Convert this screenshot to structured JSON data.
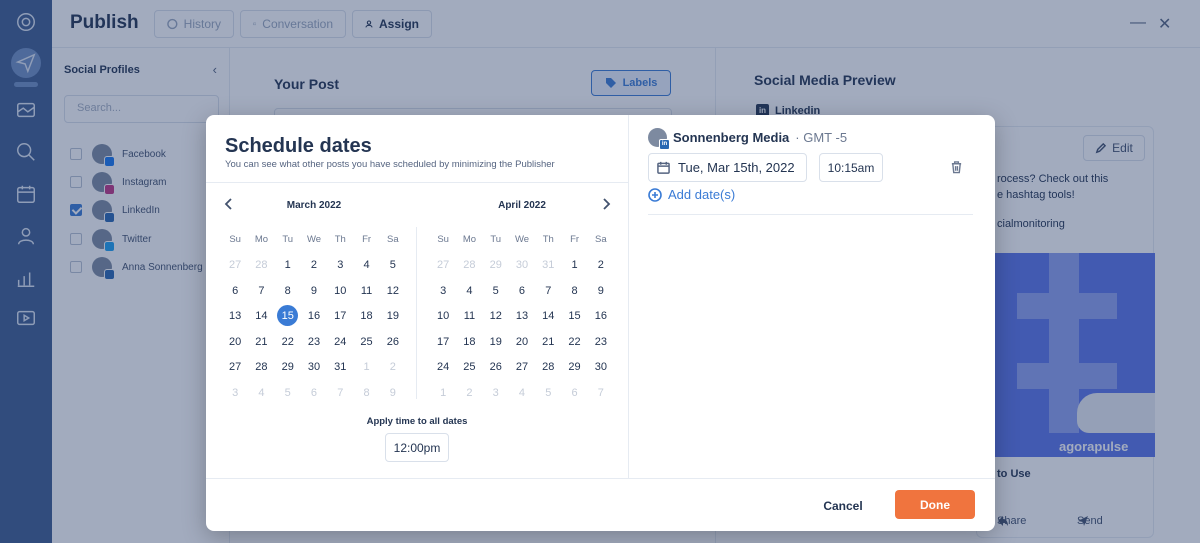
{
  "topbar": {
    "title": "Publish",
    "btn_history": "History",
    "btn_conversation": "Conversation",
    "btn_assign": "Assign"
  },
  "profiles": {
    "heading": "Social Profiles",
    "search_placeholder": "Search...",
    "items": [
      {
        "label": "Facebook",
        "checked": false,
        "badge_color": "#1877f2"
      },
      {
        "label": "Instagram",
        "checked": false,
        "badge_color": "#c13584"
      },
      {
        "label": "LinkedIn",
        "checked": true,
        "badge_color": "#2867b2"
      },
      {
        "label": "Twitter",
        "checked": false,
        "badge_color": "#1da1f2"
      },
      {
        "label": "Anna Sonnenberg",
        "checked": false,
        "badge_color": "#2867b2"
      }
    ]
  },
  "post": {
    "title": "Your Post",
    "labels_button": "Labels"
  },
  "preview": {
    "title": "Social Media Preview",
    "network": "Linkedin",
    "edit_button": "Edit",
    "text_line1": "rocess? Check out this",
    "text_line2": "e hashtag tools!",
    "text_line3": "cialmonitoring",
    "image_brand": "agorapulse",
    "link_title": "to Use",
    "share_label": "Share",
    "send_label": "Send"
  },
  "modal": {
    "title": "Schedule dates",
    "subtitle": "You can see what other posts you have scheduled by minimizing the Publisher",
    "weekdays": [
      "Su",
      "Mo",
      "Tu",
      "We",
      "Th",
      "Fr",
      "Sa"
    ],
    "calendars": [
      {
        "month": "March 2022",
        "weeks": [
          [
            [
              "27",
              1
            ],
            [
              "28",
              1
            ],
            [
              "1",
              0
            ],
            [
              "2",
              0
            ],
            [
              "3",
              0
            ],
            [
              "4",
              0
            ],
            [
              "5",
              0
            ]
          ],
          [
            [
              "6",
              0
            ],
            [
              "7",
              0
            ],
            [
              "8",
              0
            ],
            [
              "9",
              0
            ],
            [
              "10",
              0
            ],
            [
              "11",
              0
            ],
            [
              "12",
              0
            ]
          ],
          [
            [
              "13",
              0
            ],
            [
              "14",
              0
            ],
            [
              "15",
              2
            ],
            [
              "16",
              0
            ],
            [
              "17",
              0
            ],
            [
              "18",
              0
            ],
            [
              "19",
              0
            ]
          ],
          [
            [
              "20",
              0
            ],
            [
              "21",
              0
            ],
            [
              "22",
              0
            ],
            [
              "23",
              0
            ],
            [
              "24",
              0
            ],
            [
              "25",
              0
            ],
            [
              "26",
              0
            ]
          ],
          [
            [
              "27",
              0
            ],
            [
              "28",
              0
            ],
            [
              "29",
              0
            ],
            [
              "30",
              0
            ],
            [
              "31",
              0
            ],
            [
              "1",
              1
            ],
            [
              "2",
              1
            ]
          ],
          [
            [
              "3",
              1
            ],
            [
              "4",
              1
            ],
            [
              "5",
              1
            ],
            [
              "6",
              1
            ],
            [
              "7",
              1
            ],
            [
              "8",
              1
            ],
            [
              "9",
              1
            ]
          ]
        ]
      },
      {
        "month": "April 2022",
        "weeks": [
          [
            [
              "27",
              1
            ],
            [
              "28",
              1
            ],
            [
              "29",
              1
            ],
            [
              "30",
              1
            ],
            [
              "31",
              1
            ],
            [
              "1",
              0
            ],
            [
              "2",
              0
            ]
          ],
          [
            [
              "3",
              0
            ],
            [
              "4",
              0
            ],
            [
              "5",
              0
            ],
            [
              "6",
              0
            ],
            [
              "7",
              0
            ],
            [
              "8",
              0
            ],
            [
              "9",
              0
            ]
          ],
          [
            [
              "10",
              0
            ],
            [
              "11",
              0
            ],
            [
              "12",
              0
            ],
            [
              "13",
              0
            ],
            [
              "14",
              0
            ],
            [
              "15",
              0
            ],
            [
              "16",
              0
            ]
          ],
          [
            [
              "17",
              0
            ],
            [
              "18",
              0
            ],
            [
              "19",
              0
            ],
            [
              "20",
              0
            ],
            [
              "21",
              0
            ],
            [
              "22",
              0
            ],
            [
              "23",
              0
            ]
          ],
          [
            [
              "24",
              0
            ],
            [
              "25",
              0
            ],
            [
              "26",
              0
            ],
            [
              "27",
              0
            ],
            [
              "28",
              0
            ],
            [
              "29",
              0
            ],
            [
              "30",
              0
            ]
          ],
          [
            [
              "1",
              1
            ],
            [
              "2",
              1
            ],
            [
              "3",
              1
            ],
            [
              "4",
              1
            ],
            [
              "5",
              1
            ],
            [
              "6",
              1
            ],
            [
              "7",
              1
            ]
          ]
        ]
      }
    ],
    "apply_label": "Apply time to all dates",
    "apply_time": "12:00pm",
    "account_name": "Sonnenberg Media",
    "timezone": "· GMT -5",
    "date_value": "Tue, Mar 15th, 2022",
    "time_value": "10:15am",
    "add_dates": "Add date(s)",
    "cancel": "Cancel",
    "done": "Done"
  },
  "colors": {
    "accent": "#3a7bd5",
    "done": "#f0743e",
    "rail": "#3d5c8f"
  }
}
